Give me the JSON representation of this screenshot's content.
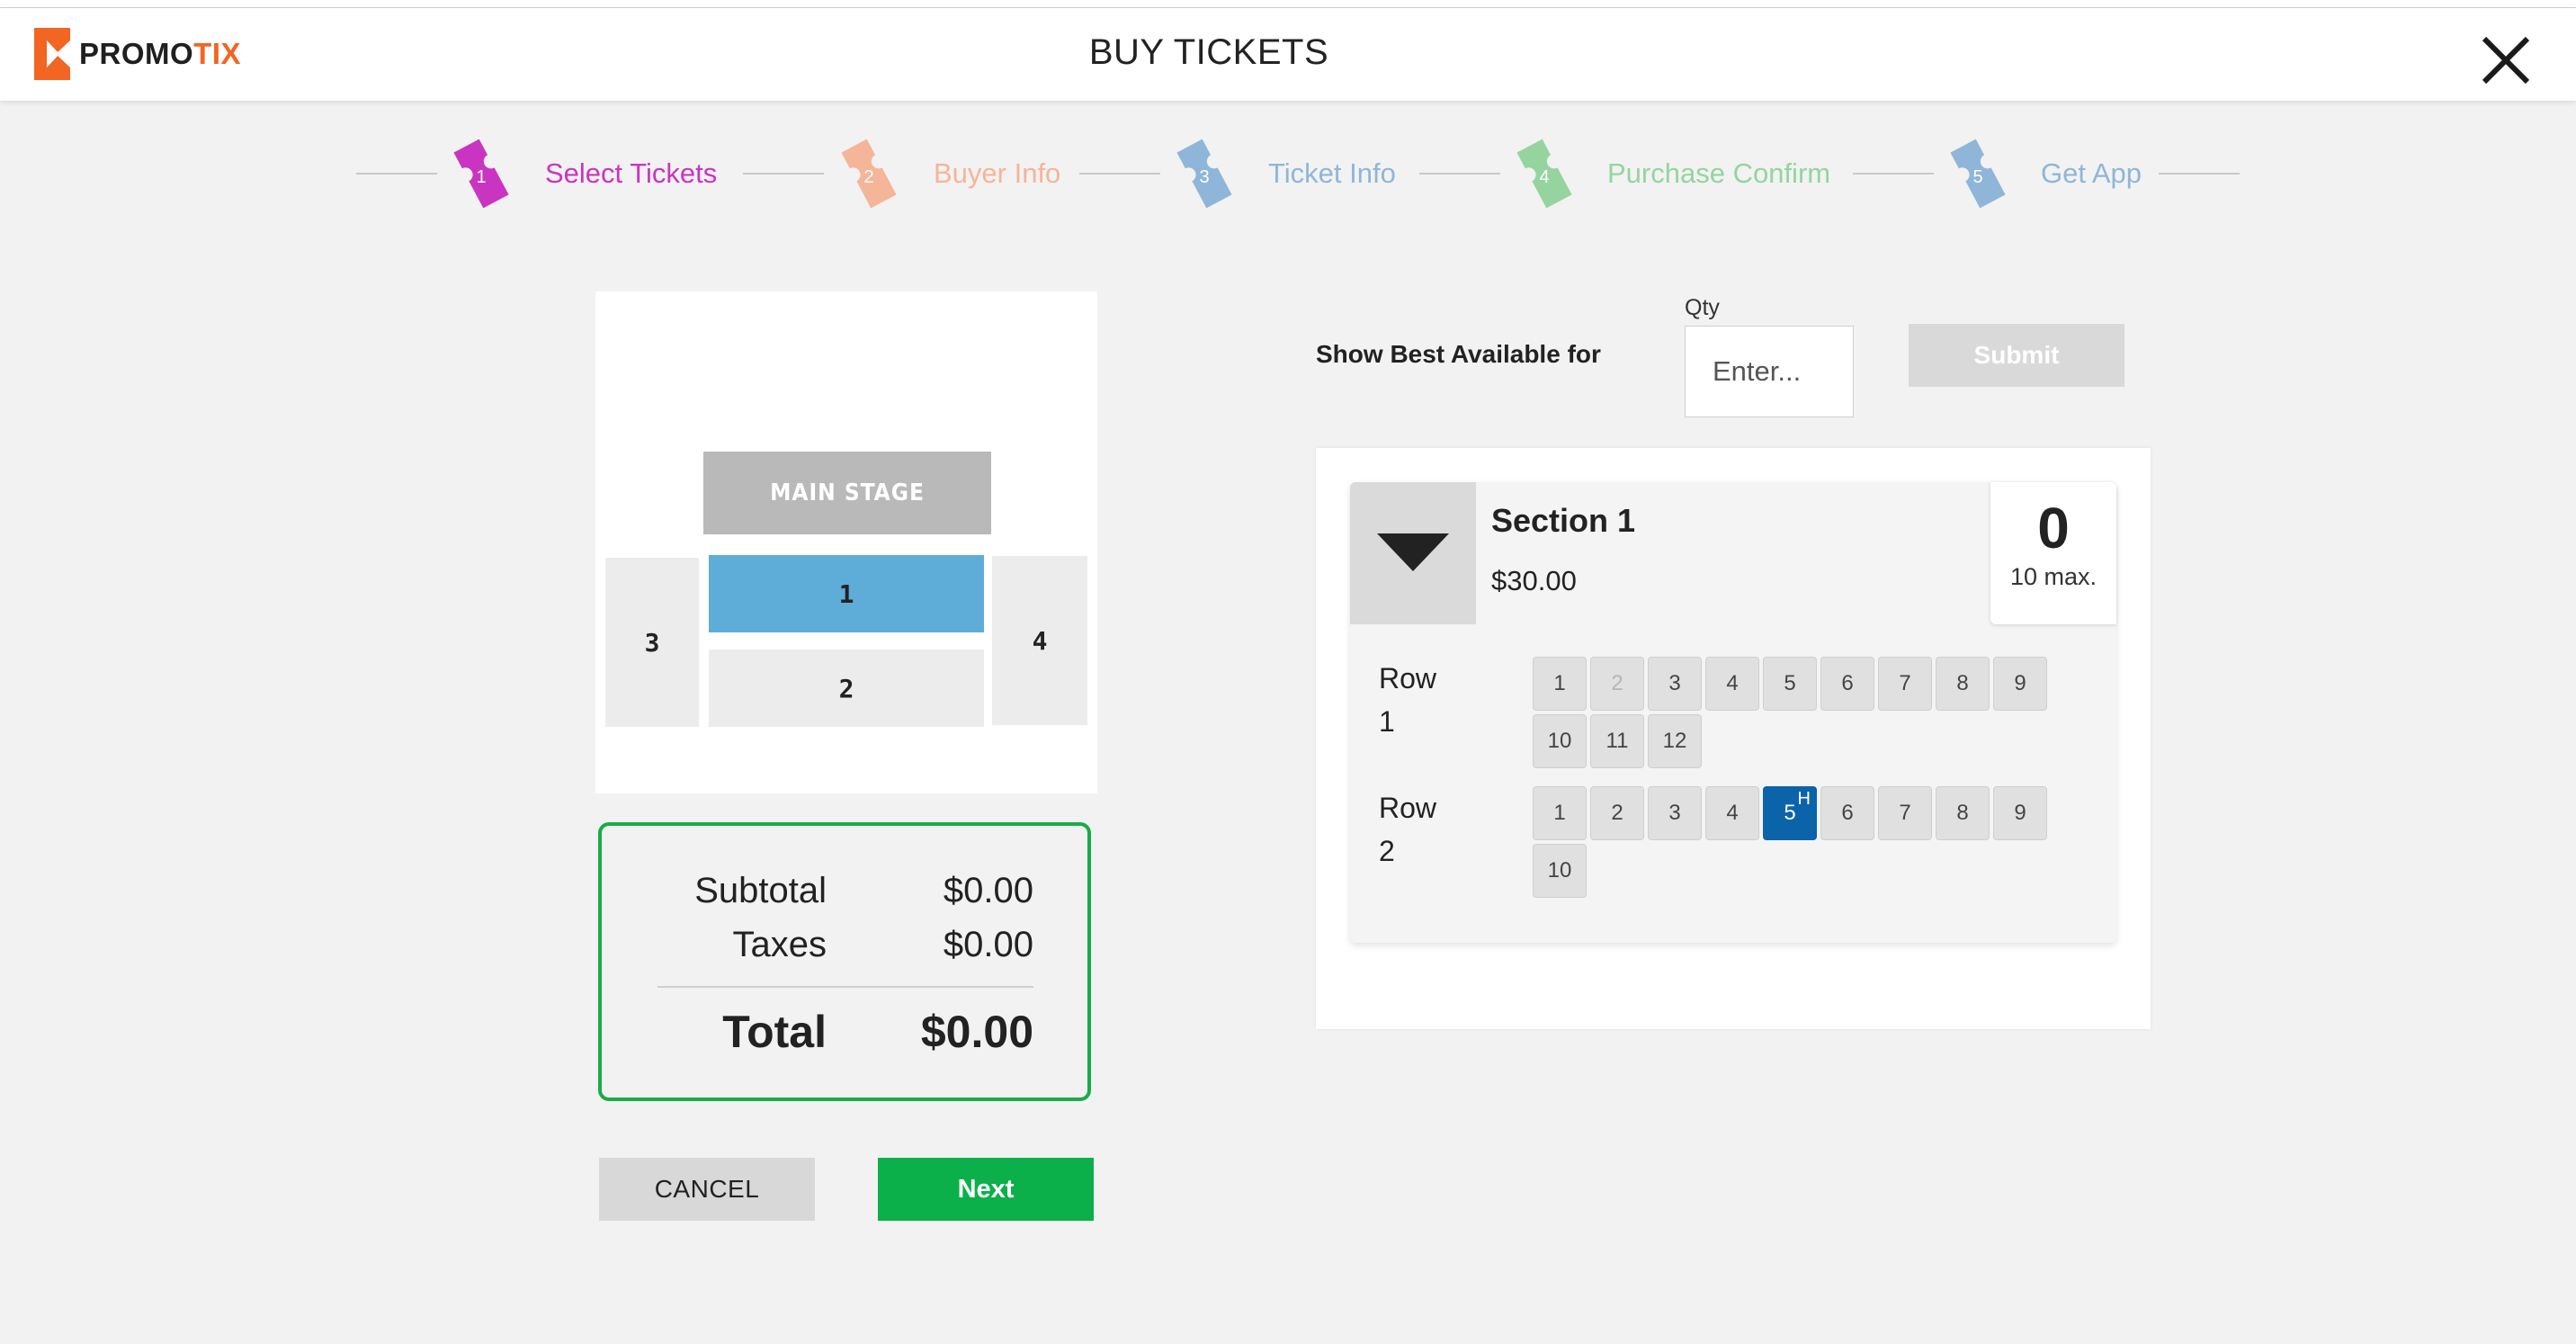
{
  "header": {
    "brand_main": "PROMO",
    "brand_accent": "TIX",
    "title": "BUY TICKETS"
  },
  "steps": [
    {
      "number": "1",
      "label": "Select Tickets",
      "color": "#c935c1",
      "active": true
    },
    {
      "number": "2",
      "label": "Buyer Info",
      "color": "#f5b598",
      "active": false
    },
    {
      "number": "3",
      "label": "Ticket Info",
      "color": "#8fb6d8",
      "active": false
    },
    {
      "number": "4",
      "label": "Purchase Confirm",
      "color": "#95d49f",
      "active": false
    },
    {
      "number": "5",
      "label": "Get App",
      "color": "#8fb6d8",
      "active": false
    }
  ],
  "venue_map": {
    "stage_label": "MAIN STAGE",
    "sections": [
      {
        "id": "1",
        "label": "1",
        "selected": true,
        "color": "#5eadd8"
      },
      {
        "id": "2",
        "label": "2",
        "selected": false,
        "color": "#ececec"
      },
      {
        "id": "3",
        "label": "3",
        "selected": false,
        "color": "#ececec"
      },
      {
        "id": "4",
        "label": "4",
        "selected": false,
        "color": "#ececec"
      }
    ]
  },
  "summary": {
    "subtotal_label": "Subtotal",
    "subtotal_value": "$0.00",
    "taxes_label": "Taxes",
    "taxes_value": "$0.00",
    "total_label": "Total",
    "total_value": "$0.00"
  },
  "actions": {
    "cancel_label": "CANCEL",
    "next_label": "Next"
  },
  "best_available": {
    "label": "Show Best Available for",
    "qty_label": "Qty",
    "qty_placeholder": "Enter...",
    "qty_value": "",
    "submit_label": "Submit"
  },
  "section": {
    "name": "Section 1",
    "price": "$30.00",
    "quantity": "0",
    "max_label": "10 max.",
    "rows": [
      {
        "label_word": "Row",
        "label_num": "1",
        "seats": [
          {
            "n": "1",
            "state": "available"
          },
          {
            "n": "2",
            "state": "unavailable"
          },
          {
            "n": "3",
            "state": "available"
          },
          {
            "n": "4",
            "state": "available"
          },
          {
            "n": "5",
            "state": "available"
          },
          {
            "n": "6",
            "state": "available"
          },
          {
            "n": "7",
            "state": "available"
          },
          {
            "n": "8",
            "state": "available"
          },
          {
            "n": "9",
            "state": "available"
          },
          {
            "n": "10",
            "state": "available"
          },
          {
            "n": "11",
            "state": "available"
          },
          {
            "n": "12",
            "state": "available"
          }
        ]
      },
      {
        "label_word": "Row",
        "label_num": "2",
        "seats": [
          {
            "n": "1",
            "state": "available"
          },
          {
            "n": "2",
            "state": "available"
          },
          {
            "n": "3",
            "state": "available"
          },
          {
            "n": "4",
            "state": "available"
          },
          {
            "n": "5",
            "state": "selected",
            "badge": "H"
          },
          {
            "n": "6",
            "state": "available"
          },
          {
            "n": "7",
            "state": "available"
          },
          {
            "n": "8",
            "state": "available"
          },
          {
            "n": "9",
            "state": "available"
          },
          {
            "n": "10",
            "state": "available"
          }
        ]
      }
    ]
  }
}
